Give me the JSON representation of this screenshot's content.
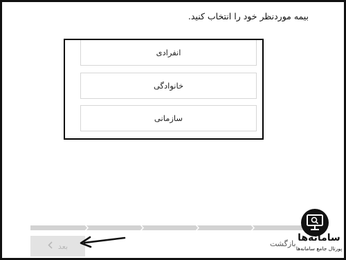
{
  "page": {
    "prompt": "بیمه موردنظر خود را انتخاب کنید."
  },
  "options": [
    {
      "label": "انفرادی"
    },
    {
      "label": "خانوادگی"
    },
    {
      "label": "سازمانی"
    }
  ],
  "footer": {
    "next_label": "بعد",
    "back_label": "بازگشت"
  },
  "watermark": {
    "title": "سامانه‌ها",
    "subtitle": "پورتال جامع سامانه‌ها"
  },
  "colors": {
    "frame": "#111111",
    "progress_track": "#d2d2d2",
    "next_button_bg": "#e3e3e3",
    "next_button_text": "#b8b8b8"
  },
  "icons": {
    "annotation_arrow": "arrow-left-icon",
    "next_chevron": "chevron-left-icon",
    "progress_separator": "chevron-right-icon",
    "logo": "monitor-search-icon"
  }
}
